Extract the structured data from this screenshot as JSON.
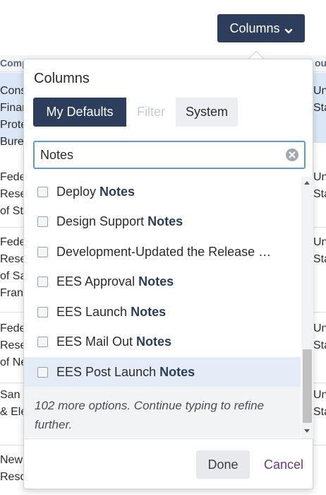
{
  "toolbar": {
    "columns_label": "Columns"
  },
  "background": {
    "header_left": "Comp",
    "header_right": "ou",
    "rows": [
      {
        "left": [
          "Cons",
          "Finan",
          "Prote",
          "Burea"
        ],
        "right": [
          "Unit",
          "Stat",
          "",
          ""
        ]
      },
      {
        "left": [
          "Feder",
          "Reser",
          "of St."
        ],
        "right": [
          "Unit",
          "Stat",
          ""
        ]
      },
      {
        "left": [
          "Feder",
          "Reser",
          "of Sa",
          "Franc"
        ],
        "right": [
          "Unit",
          "Stat",
          "",
          ""
        ]
      },
      {
        "left": [
          "Feder",
          "Reser",
          "of Ne"
        ],
        "right": [
          "Unit",
          "Stat",
          ""
        ]
      },
      {
        "left": [
          "San D",
          "& Ele"
        ],
        "right": [
          "Unit",
          "Stat"
        ]
      },
      {
        "left": [
          "New",
          "Resou"
        ],
        "right": [
          "",
          ""
        ]
      }
    ]
  },
  "popover": {
    "title": "Columns",
    "tabs": [
      "My Defaults",
      "Filter",
      "System"
    ],
    "search": {
      "value": "Notes",
      "placeholder": ""
    },
    "options": [
      {
        "prefix": "Deploy ",
        "match": "Notes"
      },
      {
        "prefix": "Design Support ",
        "match": "Notes"
      },
      {
        "prefix": "Development-Updated the Release …",
        "match": ""
      },
      {
        "prefix": "EES Approval ",
        "match": "Notes"
      },
      {
        "prefix": "EES Launch ",
        "match": "Notes"
      },
      {
        "prefix": "EES Mail Out ",
        "match": "Notes"
      },
      {
        "prefix": "EES Post Launch ",
        "match": "Notes"
      }
    ],
    "more_text": "102 more options. Continue typing to refine further.",
    "done_label": "Done",
    "cancel_label": "Cancel"
  },
  "colors": {
    "primary": "#2d3e5c",
    "focus": "#5b9bd5",
    "highlight": "#e4ecf8",
    "cancel": "#6b3a7a"
  }
}
